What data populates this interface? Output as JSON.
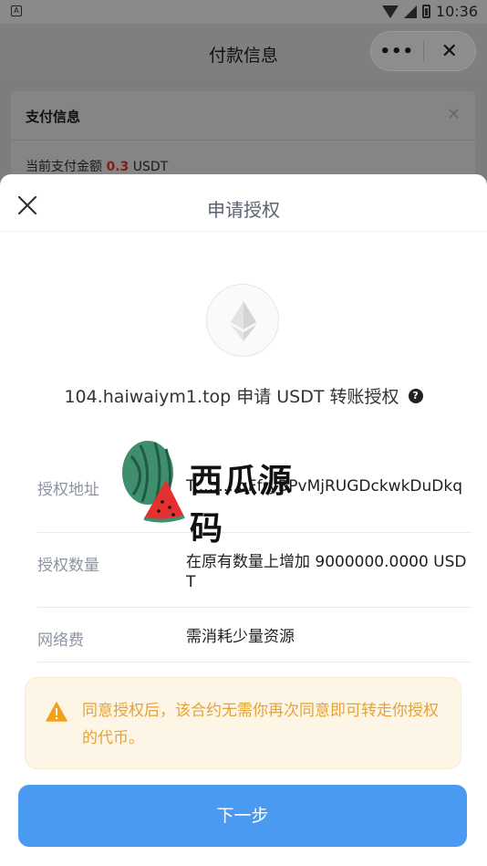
{
  "status_bar": {
    "time": "10:36",
    "left_icon_letter": "A"
  },
  "header": {
    "title": "付款信息",
    "more_label": "•••",
    "close_label": "✕"
  },
  "back_card": {
    "title": "支付信息",
    "close_label": "×",
    "amount_label": "当前支付金额",
    "amount_value": "0.3",
    "amount_unit": "USDT"
  },
  "sheet": {
    "title": "申请授权",
    "auth_text": "104.haiwaiym1.top 申请 USDT 转账授权",
    "help_label": "?",
    "rows": [
      {
        "label": "授权地址",
        "value": "T.........qFfryBPvMjRUGDckwkDuDkq"
      },
      {
        "label": "授权数量",
        "value": "在原有数量上增加 9000000.0000 USDT"
      },
      {
        "label": "网络费",
        "value": "需消耗少量资源"
      }
    ],
    "warning": "同意授权后，该合约无需你再次同意即可转走你授权的代币。",
    "next_button": "下一步"
  },
  "watermark": {
    "text": "西瓜源码"
  },
  "colors": {
    "primary": "#4a9af2",
    "warning_text": "#e3a33a",
    "warning_bg": "#fdf6e6",
    "amount_red": "#8b1a1a"
  },
  "icons": [
    "ethereum-logo",
    "close-icon",
    "help-icon",
    "warning-icon",
    "wifi-icon",
    "signal-icon",
    "battery-icon"
  ]
}
